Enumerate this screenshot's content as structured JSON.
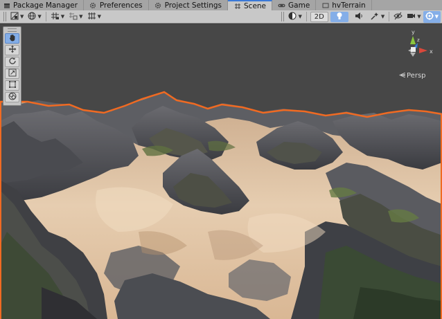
{
  "tabs": [
    {
      "label": "Package Manager",
      "icon": "package-icon",
      "active": false
    },
    {
      "label": "Preferences",
      "icon": "gear-icon",
      "active": false
    },
    {
      "label": "Project Settings",
      "icon": "gear-icon",
      "active": false
    },
    {
      "label": "Scene",
      "icon": "scene-grid-icon",
      "active": true
    },
    {
      "label": "Game",
      "icon": "gamepad-icon",
      "active": false
    },
    {
      "label": "hvTerrain",
      "icon": "window-icon",
      "active": false
    }
  ],
  "toolbar": {
    "mode_2d_label": "2D",
    "left_tools": [
      "shading-icon",
      "global-icon",
      "snap-grid-icon",
      "increment-snap-icon",
      "grid-icon"
    ],
    "right_tools": [
      "draw-mode-icon",
      "lighting-icon",
      "audio-icon",
      "effects-icon",
      "visibility-icon",
      "camera-icon",
      "gizmos-icon"
    ]
  },
  "tools_palette": {
    "items": [
      "hand-tool-icon",
      "move-tool-icon",
      "rotate-tool-icon",
      "scale-tool-icon",
      "rect-tool-icon",
      "transform-tool-icon"
    ]
  },
  "gizmo": {
    "y_label": "y",
    "z_label": "z",
    "x_label": "x",
    "projection_label": "Persp",
    "colors": {
      "x": "#d9483b",
      "y": "#8cc63f",
      "z": "#3a7bd5"
    }
  },
  "scene": {
    "selection_outline_color": "#f06a22",
    "sky_color": "#474747"
  }
}
